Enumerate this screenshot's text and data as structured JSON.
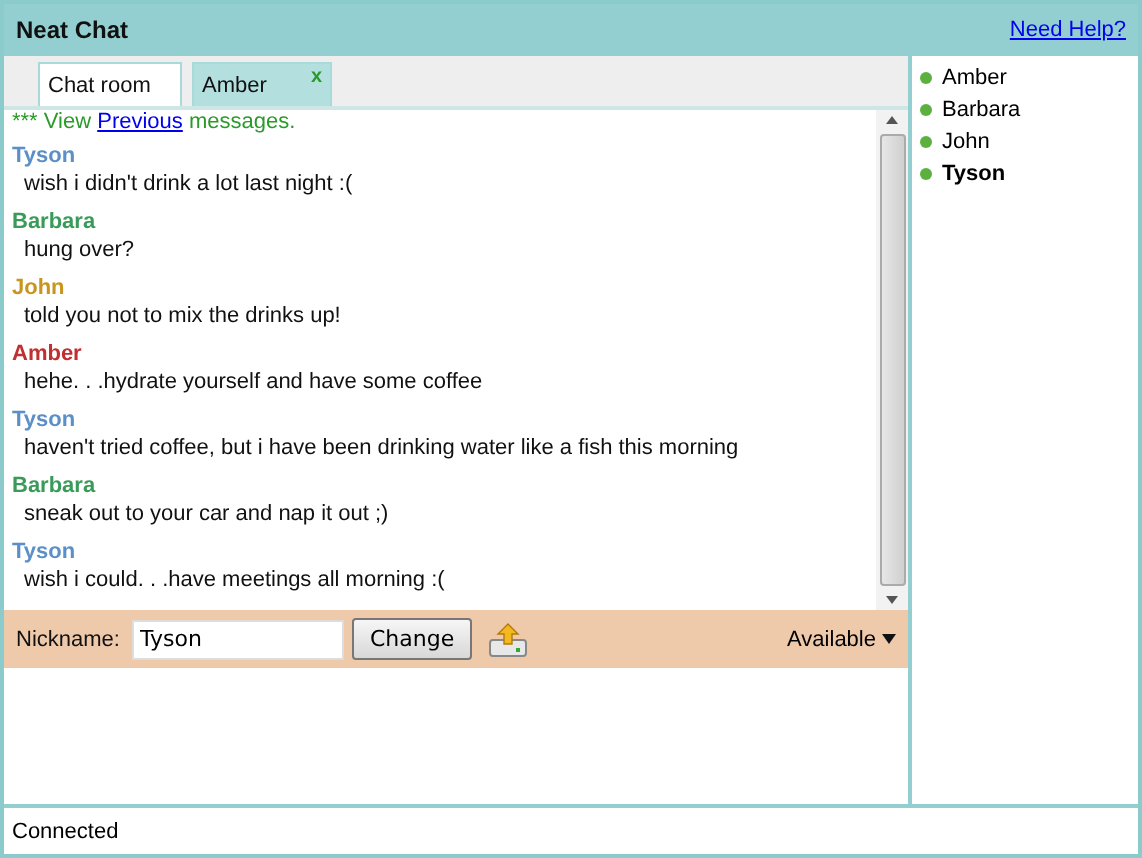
{
  "window": {
    "title": "Neat Chat",
    "help_link": "Need Help?"
  },
  "tabs": [
    {
      "label": "Chat room",
      "selected": true
    },
    {
      "label": "Amber",
      "selected": false,
      "close": "x"
    }
  ],
  "history": {
    "prefix": "*** View ",
    "link": "Previous",
    "suffix": " messages."
  },
  "messages": [
    {
      "sender": "Tyson",
      "color": "#5b8fc7",
      "text": "wish i didn't drink a lot last night :("
    },
    {
      "sender": "Barbara",
      "color": "#3a9a5a",
      "text": "hung over?"
    },
    {
      "sender": "John",
      "color": "#c8961e",
      "text": "told you not to mix the drinks up!"
    },
    {
      "sender": "Amber",
      "color": "#c03030",
      "text": "hehe. . .hydrate yourself and have some coffee"
    },
    {
      "sender": "Tyson",
      "color": "#5b8fc7",
      "text": "haven't tried coffee, but i have been drinking water like a fish this morning"
    },
    {
      "sender": "Barbara",
      "color": "#3a9a5a",
      "text": "sneak out to your car and nap it out ;)"
    },
    {
      "sender": "Tyson",
      "color": "#5b8fc7",
      "text": "wish i could. . .have meetings all morning :("
    }
  ],
  "nickname": {
    "label": "Nickname:",
    "value": "Tyson",
    "button": "Change",
    "status": "Available"
  },
  "users": [
    {
      "name": "Amber",
      "current": false,
      "color": "#5cb040"
    },
    {
      "name": "Barbara",
      "current": false,
      "color": "#5cb040"
    },
    {
      "name": "John",
      "current": false,
      "color": "#5cb040"
    },
    {
      "name": "Tyson",
      "current": true,
      "color": "#5cb040"
    }
  ],
  "status_bar": "Connected"
}
